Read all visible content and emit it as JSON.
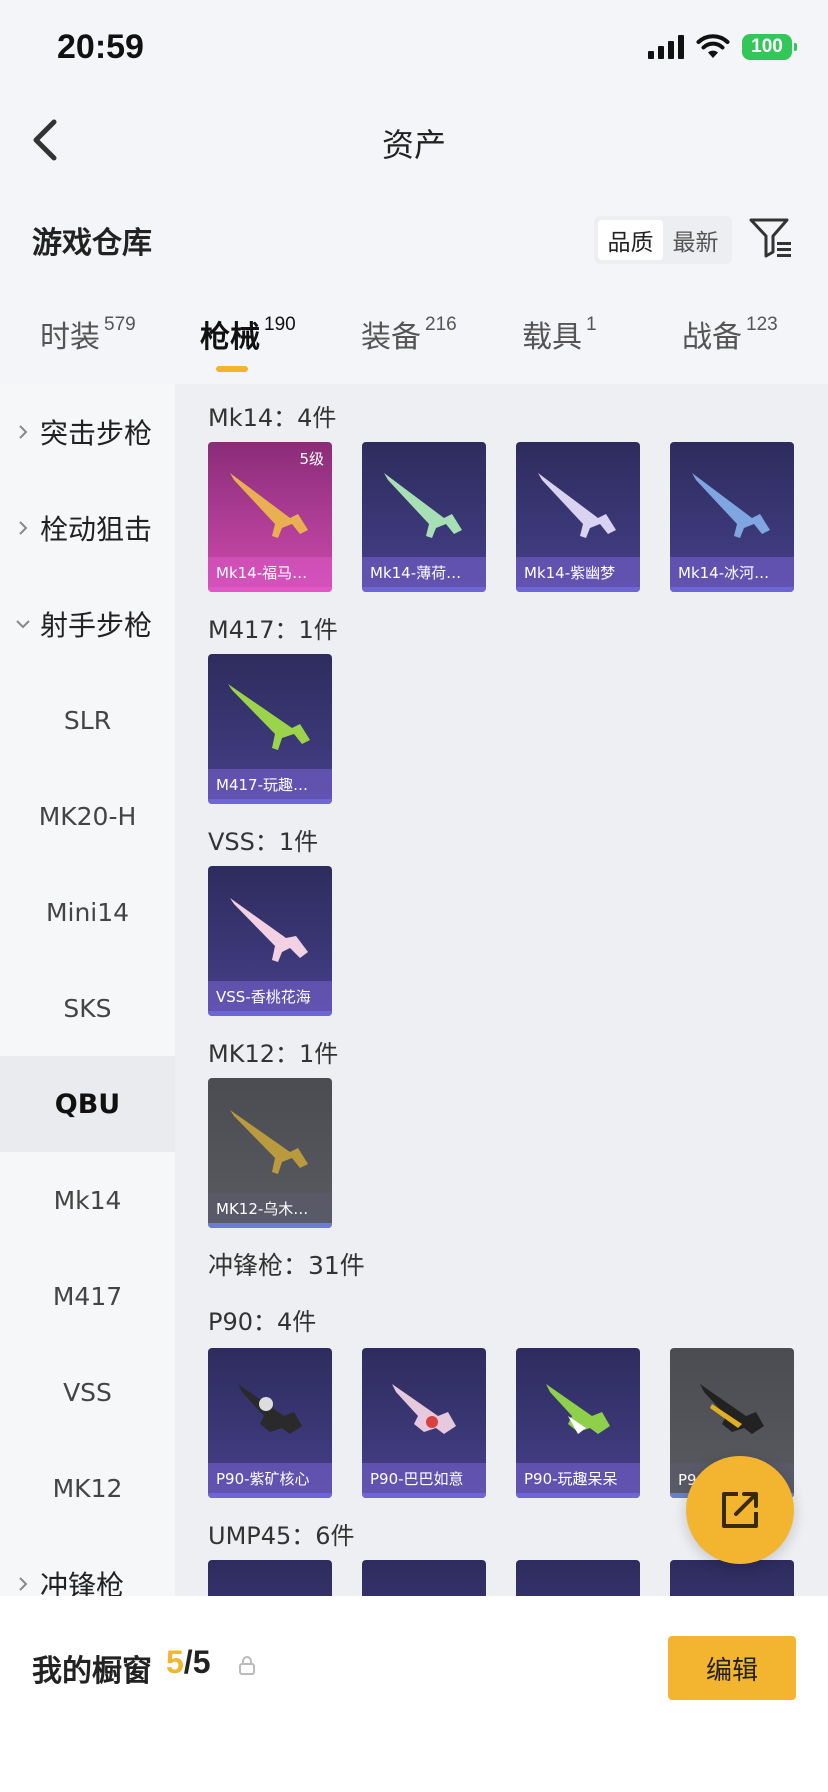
{
  "status_bar": {
    "time": "20:59",
    "battery": "100"
  },
  "header": {
    "title": "资产"
  },
  "warehouse": {
    "title": "游戏仓库",
    "sort_quality": "品质",
    "sort_newest": "最新"
  },
  "tabs": [
    {
      "label": "时装",
      "count": "579"
    },
    {
      "label": "枪械",
      "count": "190"
    },
    {
      "label": "装备",
      "count": "216"
    },
    {
      "label": "载具",
      "count": "1"
    },
    {
      "label": "战备",
      "count": "123"
    }
  ],
  "sidebar": {
    "groups": {
      "assault": "突击步枪",
      "bolt": "栓动狙击",
      "marksman": "射手步枪",
      "smg": "冲锋枪"
    },
    "items": [
      "SLR",
      "MK20-H",
      "Mini14",
      "SKS",
      "QBU",
      "Mk14",
      "M417",
      "VSS",
      "MK12"
    ]
  },
  "content": {
    "sections": {
      "mk14": "Mk14：4件",
      "m417": "M417：1件",
      "vss": "VSS：1件",
      "mk12": "MK12：1件",
      "smg": "冲锋枪：31件",
      "p90": "P90：4件",
      "ump45": "UMP45：6件"
    },
    "mk14_items": [
      {
        "name": "Mk14-福马…",
        "level": "5级"
      },
      {
        "name": "Mk14-薄荷…"
      },
      {
        "name": "Mk14-紫幽梦"
      },
      {
        "name": "Mk14-冰河…"
      }
    ],
    "m417_items": [
      {
        "name": "M417-玩趣…"
      }
    ],
    "vss_items": [
      {
        "name": "VSS-香桃花海"
      }
    ],
    "mk12_items": [
      {
        "name": "MK12-乌木…"
      }
    ],
    "p90_items": [
      {
        "name": "P90-紫矿核心"
      },
      {
        "name": "P90-巴巴如意"
      },
      {
        "name": "P90-玩趣呆呆"
      },
      {
        "name": "P9…"
      }
    ]
  },
  "showcase": {
    "label": "我的橱窗",
    "current": "5",
    "total": "/5",
    "edit": "编辑"
  },
  "colors": {
    "accent": "#f3b52f",
    "purple_card": "#3a3775",
    "pink_card": "#b33f99",
    "gray_card": "#5a5b61"
  }
}
